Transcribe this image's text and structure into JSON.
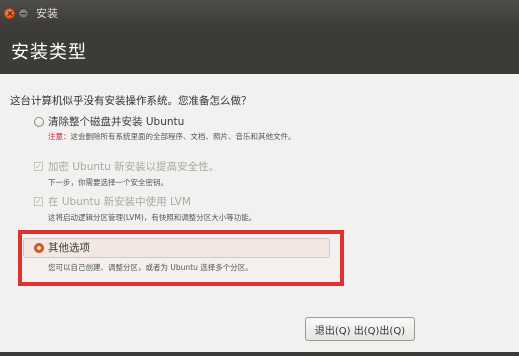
{
  "window": {
    "title": "安装",
    "close_icon": "close-icon",
    "minimize_icon": "minimize-icon"
  },
  "header": {
    "title": "安装类型"
  },
  "question": "这台计算机似乎没有安装操作系统。您准备怎么做？",
  "options": [
    {
      "label": "清除整个磁盘并安装 Ubuntu",
      "desc_warning": "注意：",
      "desc": "这会删除所有系统里面的全部程序、文档、照片、音乐和其他文件。",
      "control": "radio",
      "checked": false
    },
    {
      "label": "加密 Ubuntu 新安装以提高安全性。",
      "desc": "下一步，你需要选择一个安全密钥。",
      "control": "checkbox",
      "checked": true,
      "disabled": true
    },
    {
      "label": "在 Ubuntu 新安装中使用 LVM",
      "desc": "这将启动逻辑分区管理(LVM)，有快照和调整分区大小等功能。",
      "control": "checkbox",
      "checked": true,
      "disabled": true
    },
    {
      "label": "其他选项",
      "desc": "您可以自己创建、调整分区，或者为 Ubuntu 选择多个分区。",
      "control": "radio",
      "checked": true
    }
  ],
  "buttons": {
    "quit": "退出(Q) 出(Q)出(Q)"
  },
  "colors": {
    "accent": "#dd4814",
    "highlight_box": "#e0312f",
    "warning": "#c7162b",
    "header_bg": "#3c3b37"
  }
}
